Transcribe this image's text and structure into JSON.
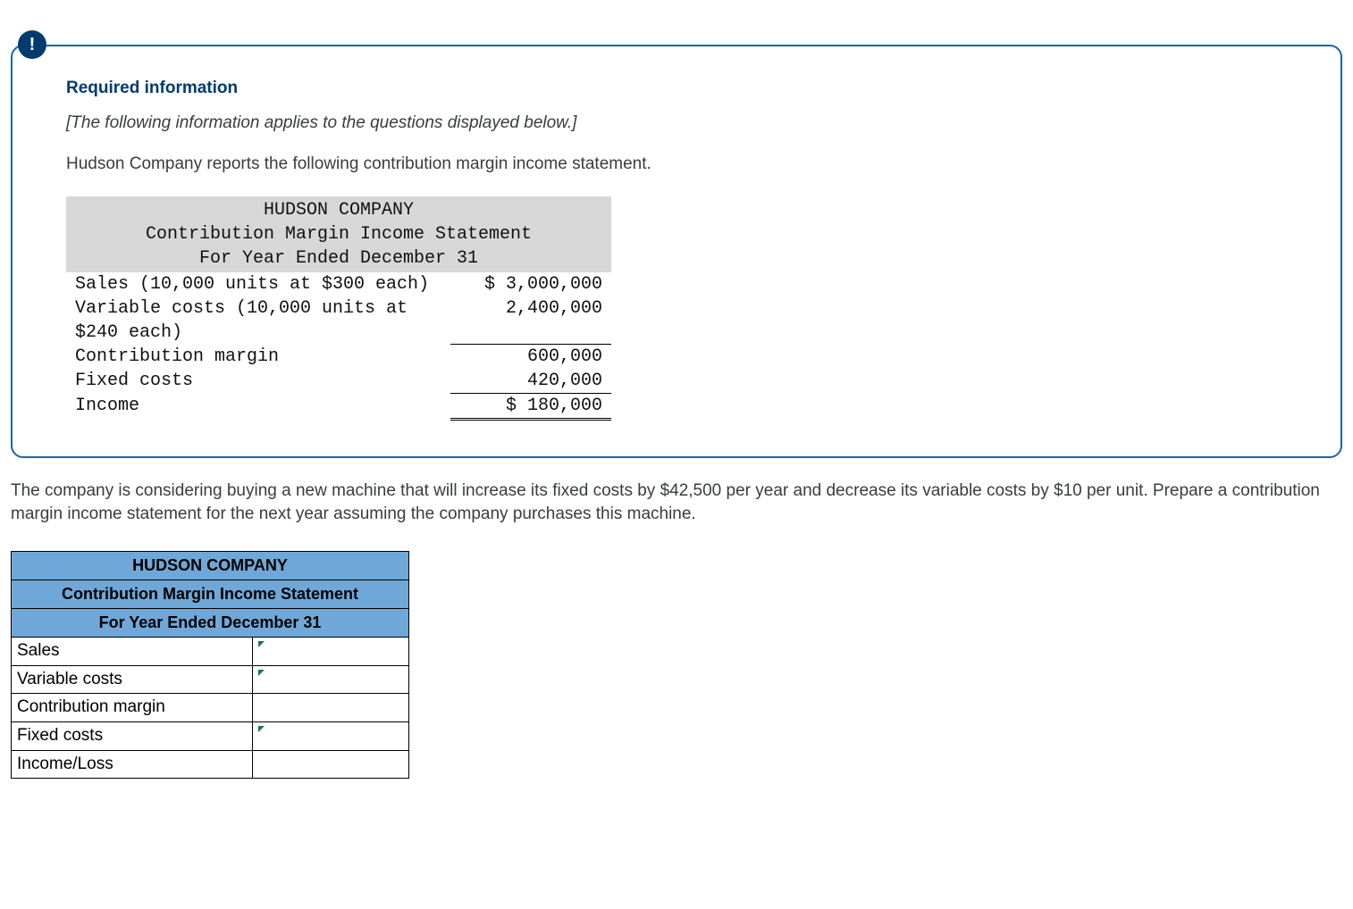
{
  "info": {
    "badge": "!",
    "heading": "Required information",
    "applies_note": "[The following information applies to the questions displayed below.]",
    "intro": "Hudson Company reports the following contribution margin income statement."
  },
  "income_statement": {
    "company": "HUDSON COMPANY",
    "title": "Contribution Margin Income Statement",
    "period": "For Year Ended December 31",
    "rows": [
      {
        "label": "Sales (10,000 units at $300 each)",
        "amount": "$ 3,000,000"
      },
      {
        "label": "Variable costs (10,000 units at $240 each)",
        "amount": "2,400,000"
      },
      {
        "label": "Contribution margin",
        "amount": "600,000"
      },
      {
        "label": "Fixed costs",
        "amount": "420,000"
      },
      {
        "label": "Income",
        "amount": "$ 180,000"
      }
    ]
  },
  "question": "The company is considering buying a new machine that will increase its fixed costs by $42,500 per year and decrease its variable costs by $10 per unit. Prepare a contribution margin income statement for the next year assuming the company purchases this machine.",
  "answer_table": {
    "company": "HUDSON COMPANY",
    "title": "Contribution Margin Income Statement",
    "period": "For Year Ended December 31",
    "rows": [
      {
        "label": "Sales",
        "editable": true
      },
      {
        "label": "Variable costs",
        "editable": true
      },
      {
        "label": "Contribution margin",
        "editable": false
      },
      {
        "label": "Fixed costs",
        "editable": true
      },
      {
        "label": "Income/Loss",
        "editable": false
      }
    ]
  }
}
